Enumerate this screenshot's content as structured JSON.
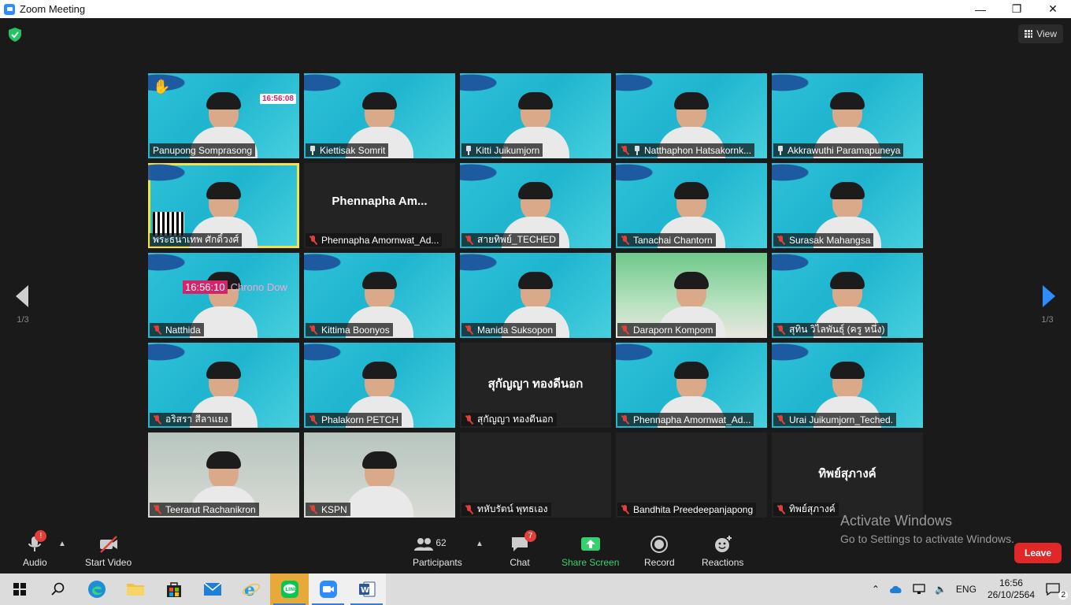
{
  "window": {
    "title": "Zoom Meeting",
    "minimize": "—",
    "maximize": "❐",
    "close": "✕"
  },
  "view_button": {
    "label": "View"
  },
  "pagination": {
    "left": "1/3",
    "right": "1/3"
  },
  "tiles": [
    {
      "name": "Panupong Somprasong",
      "kind": "cam",
      "muted": false,
      "pinned": false,
      "clock": "16:56:08",
      "hand": true
    },
    {
      "name": "Kiettisak Somrit",
      "kind": "cam",
      "muted": false,
      "pinned": true
    },
    {
      "name": "Kitti Juikumjorn",
      "kind": "cam",
      "muted": false,
      "pinned": true
    },
    {
      "name": "Natthaphon Hatsakornk...",
      "kind": "cam",
      "muted": true,
      "pinned": true
    },
    {
      "name": "Akkrawuthi Paramapuneya",
      "kind": "cam",
      "muted": false,
      "pinned": true
    },
    {
      "name": "พระธนาเทพ ศักดิ์วงศ์",
      "kind": "cam",
      "muted": false,
      "pinned": false,
      "active": true,
      "qr": true
    },
    {
      "name": "Phennapha Amornwat_Ad...",
      "kind": "nocam",
      "muted": true,
      "pinned": false,
      "big": "Phennapha  Am..."
    },
    {
      "name": "สายทิพย์_TECHED",
      "kind": "cam",
      "muted": true,
      "pinned": false
    },
    {
      "name": "Tanachai Chantorn",
      "kind": "cam",
      "muted": true,
      "pinned": false
    },
    {
      "name": "Surasak Mahangsa",
      "kind": "cam",
      "muted": true,
      "pinned": false
    },
    {
      "name": "Natthida",
      "kind": "cam",
      "muted": true,
      "pinned": false,
      "chrono_time": "16:56:10",
      "chrono_label": "Chrono Dow"
    },
    {
      "name": "Kittima Boonyos",
      "kind": "cam",
      "muted": true,
      "pinned": false
    },
    {
      "name": "Manida Suksopon",
      "kind": "cam",
      "muted": true,
      "pinned": false
    },
    {
      "name": "Daraporn Kompom",
      "kind": "green",
      "muted": true,
      "pinned": false
    },
    {
      "name": "สุทิน วิไลพันธุ์ (ครู หนึ่ง)",
      "kind": "cam",
      "muted": true,
      "pinned": false
    },
    {
      "name": "อริสรา สีลาแยง",
      "kind": "cam",
      "muted": true,
      "pinned": false
    },
    {
      "name": "Phalakorn PETCH",
      "kind": "cam",
      "muted": true,
      "pinned": false
    },
    {
      "name": "สุกัญญา ทองดีนอก",
      "kind": "nocam",
      "muted": true,
      "pinned": false,
      "big": "สุกัญญา ทองดีนอก"
    },
    {
      "name": "Phennapha Amornwat_Ad...",
      "kind": "cam",
      "muted": true,
      "pinned": false
    },
    {
      "name": "Urai Juikumjorn_Teched.",
      "kind": "cam",
      "muted": true,
      "pinned": false
    },
    {
      "name": "Teerarut Rachanikron",
      "kind": "room",
      "muted": true,
      "pinned": false
    },
    {
      "name": "KSPN",
      "kind": "room",
      "muted": true,
      "pinned": false
    },
    {
      "name": "ทหับรัตน์ พุทธเอง",
      "kind": "nocam",
      "muted": true,
      "pinned": false,
      "big": ""
    },
    {
      "name": "Bandhita Preedeepanjapong",
      "kind": "nocam",
      "muted": true,
      "pinned": false,
      "big": ""
    },
    {
      "name": "ทิพย์สุภางค์",
      "kind": "nocam",
      "muted": true,
      "pinned": false,
      "big": "ทิพย์สุภางค์"
    }
  ],
  "toolbar": {
    "audio": "Audio",
    "video": "Start Video",
    "participants": "Participants",
    "participants_count": "62",
    "chat": "Chat",
    "chat_badge": "7",
    "share": "Share Screen",
    "record": "Record",
    "reactions": "Reactions",
    "leave": "Leave",
    "audio_badge": "!"
  },
  "watermark": {
    "line1": "Activate Windows",
    "line2": "Go to Settings to activate Windows."
  },
  "taskbar": {
    "lang": "ENG",
    "time": "16:56",
    "date": "26/10/2564",
    "notif_count": "2"
  },
  "colors": {
    "accent": "#2d8cff",
    "share": "#36d16e",
    "leave": "#e02828",
    "active_speaker": "#f2e34a"
  }
}
